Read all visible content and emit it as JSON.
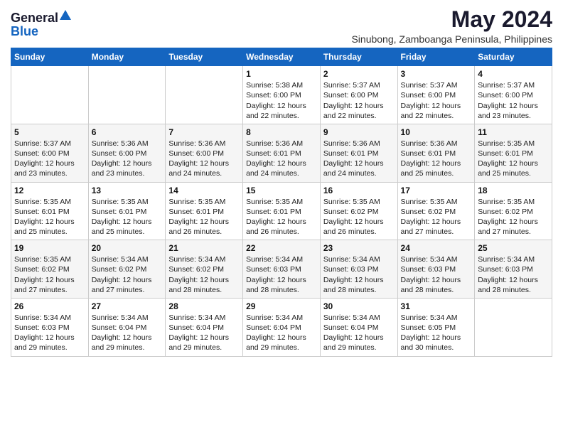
{
  "logo": {
    "general": "General",
    "blue": "Blue"
  },
  "title": "May 2024",
  "subtitle": "Sinubong, Zamboanga Peninsula, Philippines",
  "days_of_week": [
    "Sunday",
    "Monday",
    "Tuesday",
    "Wednesday",
    "Thursday",
    "Friday",
    "Saturday"
  ],
  "weeks": [
    [
      {
        "day": "",
        "sunrise": "",
        "sunset": "",
        "daylight": ""
      },
      {
        "day": "",
        "sunrise": "",
        "sunset": "",
        "daylight": ""
      },
      {
        "day": "",
        "sunrise": "",
        "sunset": "",
        "daylight": ""
      },
      {
        "day": "1",
        "sunrise": "Sunrise: 5:38 AM",
        "sunset": "Sunset: 6:00 PM",
        "daylight": "Daylight: 12 hours and 22 minutes."
      },
      {
        "day": "2",
        "sunrise": "Sunrise: 5:37 AM",
        "sunset": "Sunset: 6:00 PM",
        "daylight": "Daylight: 12 hours and 22 minutes."
      },
      {
        "day": "3",
        "sunrise": "Sunrise: 5:37 AM",
        "sunset": "Sunset: 6:00 PM",
        "daylight": "Daylight: 12 hours and 22 minutes."
      },
      {
        "day": "4",
        "sunrise": "Sunrise: 5:37 AM",
        "sunset": "Sunset: 6:00 PM",
        "daylight": "Daylight: 12 hours and 23 minutes."
      }
    ],
    [
      {
        "day": "5",
        "sunrise": "Sunrise: 5:37 AM",
        "sunset": "Sunset: 6:00 PM",
        "daylight": "Daylight: 12 hours and 23 minutes."
      },
      {
        "day": "6",
        "sunrise": "Sunrise: 5:36 AM",
        "sunset": "Sunset: 6:00 PM",
        "daylight": "Daylight: 12 hours and 23 minutes."
      },
      {
        "day": "7",
        "sunrise": "Sunrise: 5:36 AM",
        "sunset": "Sunset: 6:00 PM",
        "daylight": "Daylight: 12 hours and 24 minutes."
      },
      {
        "day": "8",
        "sunrise": "Sunrise: 5:36 AM",
        "sunset": "Sunset: 6:01 PM",
        "daylight": "Daylight: 12 hours and 24 minutes."
      },
      {
        "day": "9",
        "sunrise": "Sunrise: 5:36 AM",
        "sunset": "Sunset: 6:01 PM",
        "daylight": "Daylight: 12 hours and 24 minutes."
      },
      {
        "day": "10",
        "sunrise": "Sunrise: 5:36 AM",
        "sunset": "Sunset: 6:01 PM",
        "daylight": "Daylight: 12 hours and 25 minutes."
      },
      {
        "day": "11",
        "sunrise": "Sunrise: 5:35 AM",
        "sunset": "Sunset: 6:01 PM",
        "daylight": "Daylight: 12 hours and 25 minutes."
      }
    ],
    [
      {
        "day": "12",
        "sunrise": "Sunrise: 5:35 AM",
        "sunset": "Sunset: 6:01 PM",
        "daylight": "Daylight: 12 hours and 25 minutes."
      },
      {
        "day": "13",
        "sunrise": "Sunrise: 5:35 AM",
        "sunset": "Sunset: 6:01 PM",
        "daylight": "Daylight: 12 hours and 25 minutes."
      },
      {
        "day": "14",
        "sunrise": "Sunrise: 5:35 AM",
        "sunset": "Sunset: 6:01 PM",
        "daylight": "Daylight: 12 hours and 26 minutes."
      },
      {
        "day": "15",
        "sunrise": "Sunrise: 5:35 AM",
        "sunset": "Sunset: 6:01 PM",
        "daylight": "Daylight: 12 hours and 26 minutes."
      },
      {
        "day": "16",
        "sunrise": "Sunrise: 5:35 AM",
        "sunset": "Sunset: 6:02 PM",
        "daylight": "Daylight: 12 hours and 26 minutes."
      },
      {
        "day": "17",
        "sunrise": "Sunrise: 5:35 AM",
        "sunset": "Sunset: 6:02 PM",
        "daylight": "Daylight: 12 hours and 27 minutes."
      },
      {
        "day": "18",
        "sunrise": "Sunrise: 5:35 AM",
        "sunset": "Sunset: 6:02 PM",
        "daylight": "Daylight: 12 hours and 27 minutes."
      }
    ],
    [
      {
        "day": "19",
        "sunrise": "Sunrise: 5:35 AM",
        "sunset": "Sunset: 6:02 PM",
        "daylight": "Daylight: 12 hours and 27 minutes."
      },
      {
        "day": "20",
        "sunrise": "Sunrise: 5:34 AM",
        "sunset": "Sunset: 6:02 PM",
        "daylight": "Daylight: 12 hours and 27 minutes."
      },
      {
        "day": "21",
        "sunrise": "Sunrise: 5:34 AM",
        "sunset": "Sunset: 6:02 PM",
        "daylight": "Daylight: 12 hours and 28 minutes."
      },
      {
        "day": "22",
        "sunrise": "Sunrise: 5:34 AM",
        "sunset": "Sunset: 6:03 PM",
        "daylight": "Daylight: 12 hours and 28 minutes."
      },
      {
        "day": "23",
        "sunrise": "Sunrise: 5:34 AM",
        "sunset": "Sunset: 6:03 PM",
        "daylight": "Daylight: 12 hours and 28 minutes."
      },
      {
        "day": "24",
        "sunrise": "Sunrise: 5:34 AM",
        "sunset": "Sunset: 6:03 PM",
        "daylight": "Daylight: 12 hours and 28 minutes."
      },
      {
        "day": "25",
        "sunrise": "Sunrise: 5:34 AM",
        "sunset": "Sunset: 6:03 PM",
        "daylight": "Daylight: 12 hours and 28 minutes."
      }
    ],
    [
      {
        "day": "26",
        "sunrise": "Sunrise: 5:34 AM",
        "sunset": "Sunset: 6:03 PM",
        "daylight": "Daylight: 12 hours and 29 minutes."
      },
      {
        "day": "27",
        "sunrise": "Sunrise: 5:34 AM",
        "sunset": "Sunset: 6:04 PM",
        "daylight": "Daylight: 12 hours and 29 minutes."
      },
      {
        "day": "28",
        "sunrise": "Sunrise: 5:34 AM",
        "sunset": "Sunset: 6:04 PM",
        "daylight": "Daylight: 12 hours and 29 minutes."
      },
      {
        "day": "29",
        "sunrise": "Sunrise: 5:34 AM",
        "sunset": "Sunset: 6:04 PM",
        "daylight": "Daylight: 12 hours and 29 minutes."
      },
      {
        "day": "30",
        "sunrise": "Sunrise: 5:34 AM",
        "sunset": "Sunset: 6:04 PM",
        "daylight": "Daylight: 12 hours and 29 minutes."
      },
      {
        "day": "31",
        "sunrise": "Sunrise: 5:34 AM",
        "sunset": "Sunset: 6:05 PM",
        "daylight": "Daylight: 12 hours and 30 minutes."
      },
      {
        "day": "",
        "sunrise": "",
        "sunset": "",
        "daylight": ""
      }
    ]
  ]
}
